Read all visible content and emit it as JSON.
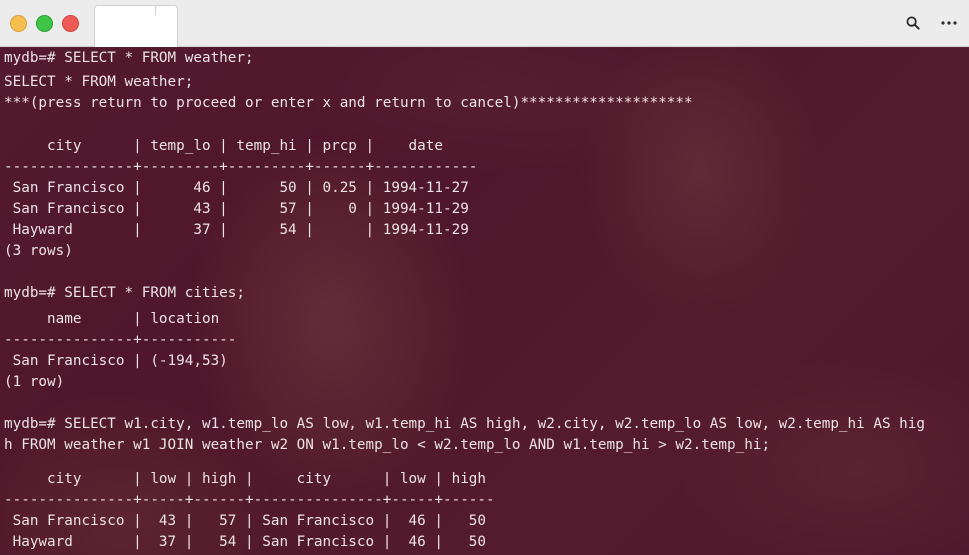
{
  "titlebar": {
    "tab_title": "",
    "search_icon": "search-icon",
    "menu_icon": "more-horizontal-icon"
  },
  "terminal": {
    "lines": [
      "mydb=# SELECT * FROM weather;",
      "SELECT * FROM weather;",
      "***(press return to proceed or enter x and return to cancel)********************",
      "",
      "     city      | temp_lo | temp_hi | prcp |    date",
      "---------------+---------+---------+------+------------",
      " San Francisco |      46 |      50 | 0.25 | 1994-11-27",
      " San Francisco |      43 |      57 |    0 | 1994-11-29",
      " Hayward       |      37 |      54 |      | 1994-11-29",
      "(3 rows)",
      "",
      "mydb=# SELECT * FROM cities;",
      "     name      | location",
      "---------------+-----------",
      " San Francisco | (-194,53)",
      "(1 row)",
      "",
      "mydb=# SELECT w1.city, w1.temp_lo AS low, w1.temp_hi AS high, w2.city, w2.temp_lo AS low, w2.temp_hi AS hig",
      "h FROM weather w1 JOIN weather w2 ON w1.temp_lo < w2.temp_lo AND w1.temp_hi > w2.temp_hi;",
      "",
      "     city      | low | high |     city      | low | high",
      "---------------+-----+------+---------------+-----+------",
      " San Francisco |  43 |   57 | San Francisco |  46 |   50",
      " Hayward       |  37 |   54 | San Francisco |  46 |   50"
    ]
  }
}
